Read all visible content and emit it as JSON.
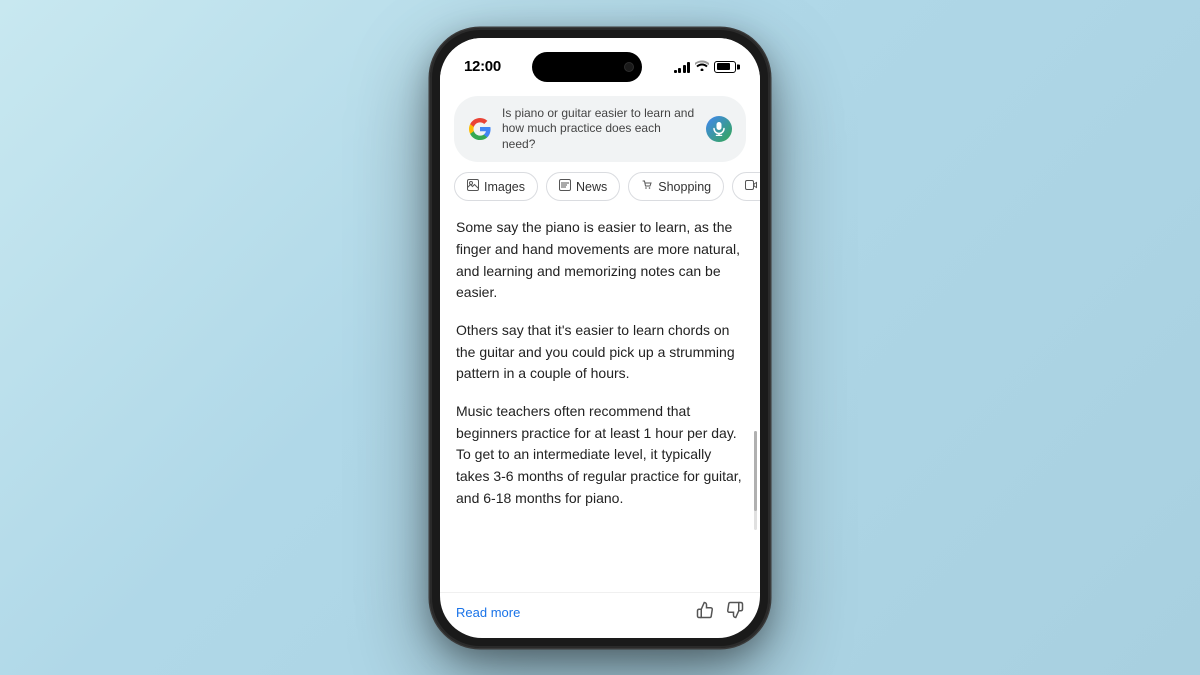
{
  "background": {
    "color_start": "#c8e8f0",
    "color_end": "#a8d0e0"
  },
  "phone": {
    "status_bar": {
      "time": "12:00",
      "signal_label": "signal",
      "wifi_label": "wifi",
      "battery_label": "battery"
    },
    "search": {
      "query": "Is piano or guitar easier to learn and how much practice does each need?",
      "mic_label": "microphone"
    },
    "filter_tabs": [
      {
        "label": "Images",
        "icon": "🖼"
      },
      {
        "label": "News",
        "icon": "📰"
      },
      {
        "label": "Shopping",
        "icon": "🏷"
      },
      {
        "label": "Vid...",
        "icon": "▶"
      }
    ],
    "answer": {
      "paragraphs": [
        "Some say the piano is easier to learn, as the finger and hand movements are more natural, and learning and memorizing notes can be easier.",
        "Others say that it's easier to learn chords on the guitar and you could pick up a strumming pattern in a couple of hours.",
        "Music teachers often recommend that beginners practice for at least 1 hour per day. To get to an intermediate level, it typically takes 3-6 months of regular practice for guitar, and 6-18 months for piano."
      ]
    },
    "footer": {
      "read_more_label": "Read more",
      "thumbs_up_label": "👍",
      "thumbs_down_label": "👎"
    }
  }
}
